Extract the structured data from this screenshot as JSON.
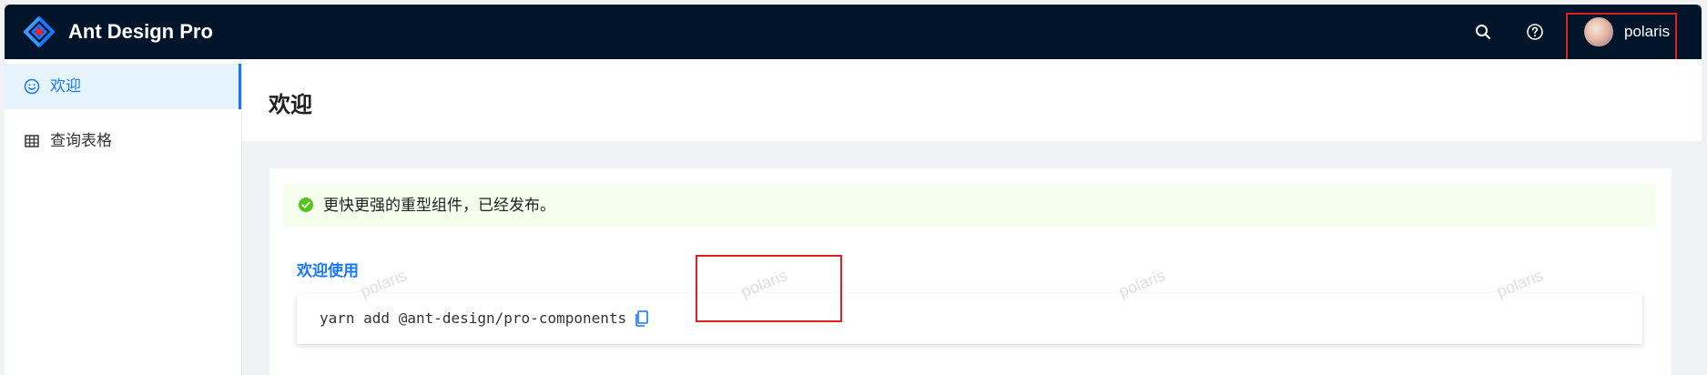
{
  "app": {
    "title": "Ant Design Pro"
  },
  "header": {
    "icons": [
      "search-icon",
      "question-circle-icon"
    ],
    "user": {
      "name": "polaris"
    }
  },
  "sidebar": {
    "items": [
      {
        "label": "欢迎",
        "icon": "smile-icon",
        "active": true
      },
      {
        "label": "查询表格",
        "icon": "table-icon",
        "active": false
      }
    ]
  },
  "page": {
    "title": "欢迎"
  },
  "alert": {
    "text": "更快更强的重型组件，已经发布。",
    "icon": "check-circle-icon"
  },
  "card": {
    "section_link": "欢迎使用",
    "code": "yarn add @ant-design/pro-components"
  },
  "watermark": {
    "text": "polaris"
  },
  "colors": {
    "header_bg": "#001529",
    "accent": "#1677ff",
    "success": "#52c41a",
    "alert_bg": "#f6ffed",
    "highlight": "#e02020"
  }
}
